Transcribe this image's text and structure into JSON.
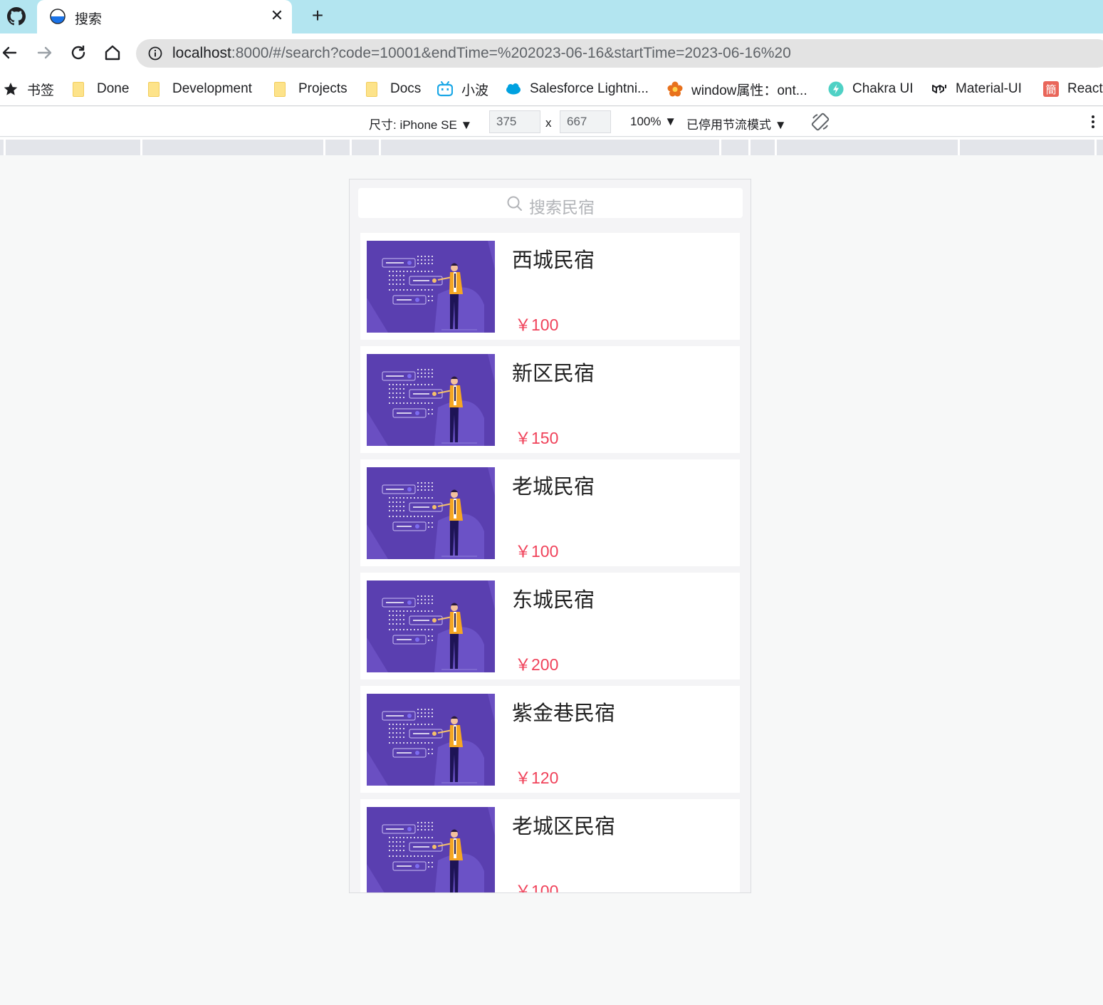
{
  "tab": {
    "title": "搜索"
  },
  "address_bar": {
    "url_host": "localhost",
    "url_rest": ":8000/#/search?code=10001&endTime=%202023-06-16&startTime=2023-06-16%20"
  },
  "bookmarks": [
    {
      "label": "书签",
      "icon": "star-icon"
    },
    {
      "label": "Done",
      "icon": "folder-icon"
    },
    {
      "label": "Development",
      "icon": "folder-icon"
    },
    {
      "label": "Projects",
      "icon": "folder-icon"
    },
    {
      "label": "Docs",
      "icon": "folder-icon"
    },
    {
      "label": "小波",
      "icon": "bilibili-icon"
    },
    {
      "label": "Salesforce Lightni...",
      "icon": "salesforce-icon"
    },
    {
      "label": "window属性：ont...",
      "icon": "flower-icon"
    },
    {
      "label": "Chakra UI",
      "icon": "chakra-icon"
    },
    {
      "label": "Material-UI",
      "icon": "mui-icon"
    },
    {
      "label": "React",
      "icon": "jianshu-icon"
    }
  ],
  "device_toolbar": {
    "device": "尺寸: iPhone SE",
    "width": "375",
    "times": "x",
    "height": "667",
    "zoom": "100%",
    "throttle": "已停用节流模式"
  },
  "search": {
    "placeholder": "搜索民宿"
  },
  "listings": [
    {
      "name": "西城民宿",
      "price": "￥100"
    },
    {
      "name": "新区民宿",
      "price": "￥150"
    },
    {
      "name": "老城民宿",
      "price": "￥100"
    },
    {
      "name": "东城民宿",
      "price": "￥200"
    },
    {
      "name": "紫金巷民宿",
      "price": "￥120"
    },
    {
      "name": "老城区民宿",
      "price": "￥100"
    }
  ],
  "colors": {
    "tabstrip": "#b3e5f0",
    "price": "#f0425a",
    "thumb_bg": "#5a3fb0",
    "accent_yellow": "#f5a623"
  }
}
